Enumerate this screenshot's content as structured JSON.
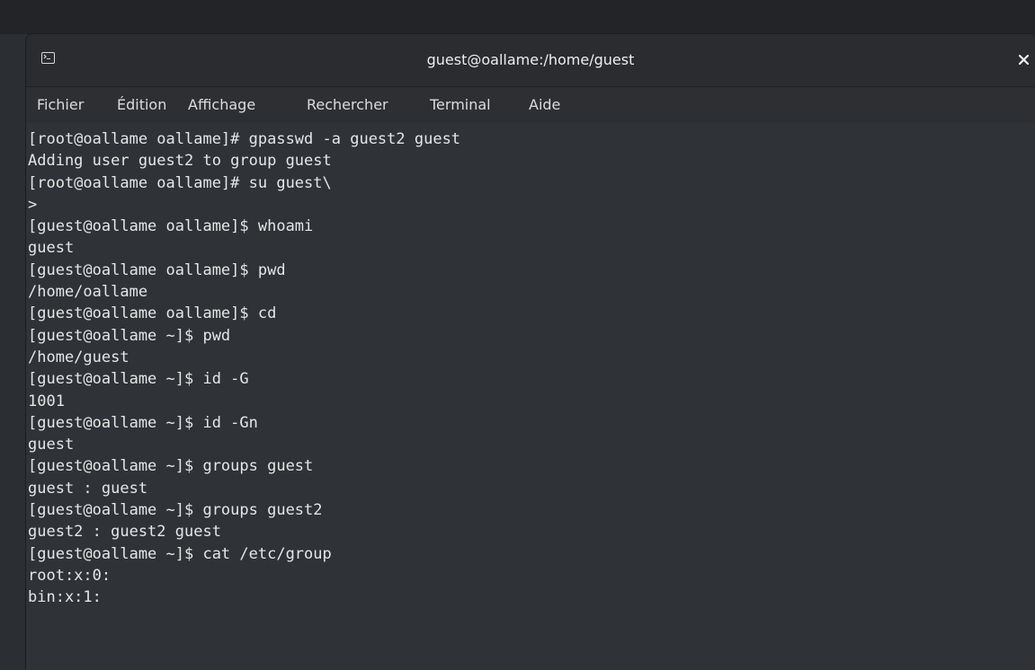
{
  "window": {
    "title": "guest@oallame:/home/guest",
    "close_glyph": "×"
  },
  "menu": {
    "items": [
      {
        "label": "Fichier"
      },
      {
        "label": "Édition"
      },
      {
        "label": "Affichage"
      },
      {
        "label": "Rechercher"
      },
      {
        "label": "Terminal"
      },
      {
        "label": "Aide"
      }
    ]
  },
  "terminal": {
    "lines": [
      "[root@oallame oallame]# gpasswd -a guest2 guest",
      "Adding user guest2 to group guest",
      "[root@oallame oallame]# su guest\\",
      ">",
      "[guest@oallame oallame]$ whoami",
      "guest",
      "[guest@oallame oallame]$ pwd",
      "/home/oallame",
      "[guest@oallame oallame]$ cd",
      "[guest@oallame ~]$ pwd",
      "/home/guest",
      "[guest@oallame ~]$ id -G",
      "1001",
      "[guest@oallame ~]$ id -Gn",
      "guest",
      "[guest@oallame ~]$ groups guest",
      "guest : guest",
      "[guest@oallame ~]$ groups guest2",
      "guest2 : guest2 guest",
      "[guest@oallame ~]$ cat /etc/group",
      "root:x:0:",
      "bin:x:1:"
    ]
  },
  "icons": {
    "app": "terminal-icon",
    "close": "close-icon"
  },
  "colors": {
    "terminal_bg": "#2f3237",
    "text": "#e6e6e6",
    "titlebar_bg": "#2a2c30"
  }
}
